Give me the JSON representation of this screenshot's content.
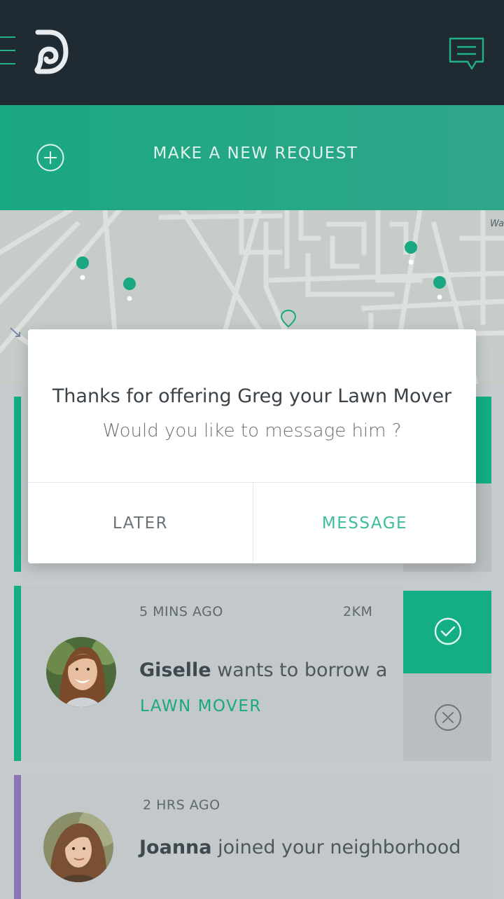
{
  "banner": {
    "label": "MAKE A NEW REQUEST"
  },
  "map": {
    "partial_label": "Wa"
  },
  "dialog": {
    "title": "Thanks for offering Greg your Lawn Mover",
    "subtitle": "Would you like to message him ?",
    "later_label": "LATER",
    "message_label": "MESSAGE"
  },
  "feed": [
    {
      "time": "5 MINS AGO",
      "distance": "2KM",
      "name": "Giselle",
      "text": " wants to borrow a",
      "item": "LAWN MOVER",
      "accent": "#13ae84"
    },
    {
      "time": "2 HRS AGO",
      "name": "Joanna",
      "text": " joined your neighborhood",
      "accent": "#8c74b4"
    }
  ],
  "colors": {
    "topbar": "#1f2a33",
    "brand": "#1aa881",
    "accent_alt": "#8c74b4"
  }
}
